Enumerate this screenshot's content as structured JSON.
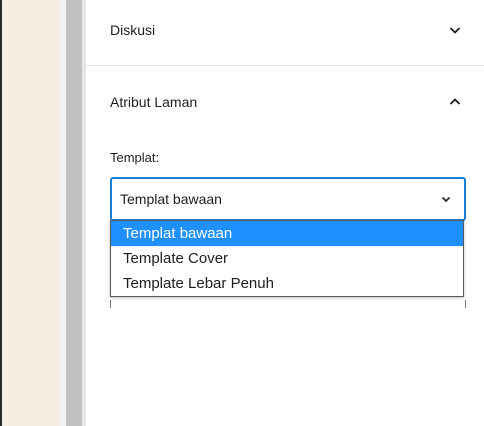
{
  "sidebar": {
    "panels": [
      {
        "title": "Diskusi",
        "expanded": false,
        "chevron_icon": "chevron-down-icon"
      },
      {
        "title": "Atribut Laman",
        "expanded": true,
        "chevron_icon": "chevron-up-icon"
      }
    ],
    "page_attributes": {
      "template_label": "Templat:",
      "template_select": {
        "value": "Templat bawaan",
        "chevron_icon": "chevron-down-icon",
        "options": [
          "Templat bawaan",
          "Template Cover",
          "Template Lebar Penuh"
        ],
        "selected_index": 0
      }
    }
  },
  "colors": {
    "canvas_background": "#f4efe2",
    "scrollbar_thumb": "#c1c1c1",
    "focus_border": "#1d7fd6",
    "option_highlight": "#1e90ff",
    "divider": "#e0e0e0"
  }
}
